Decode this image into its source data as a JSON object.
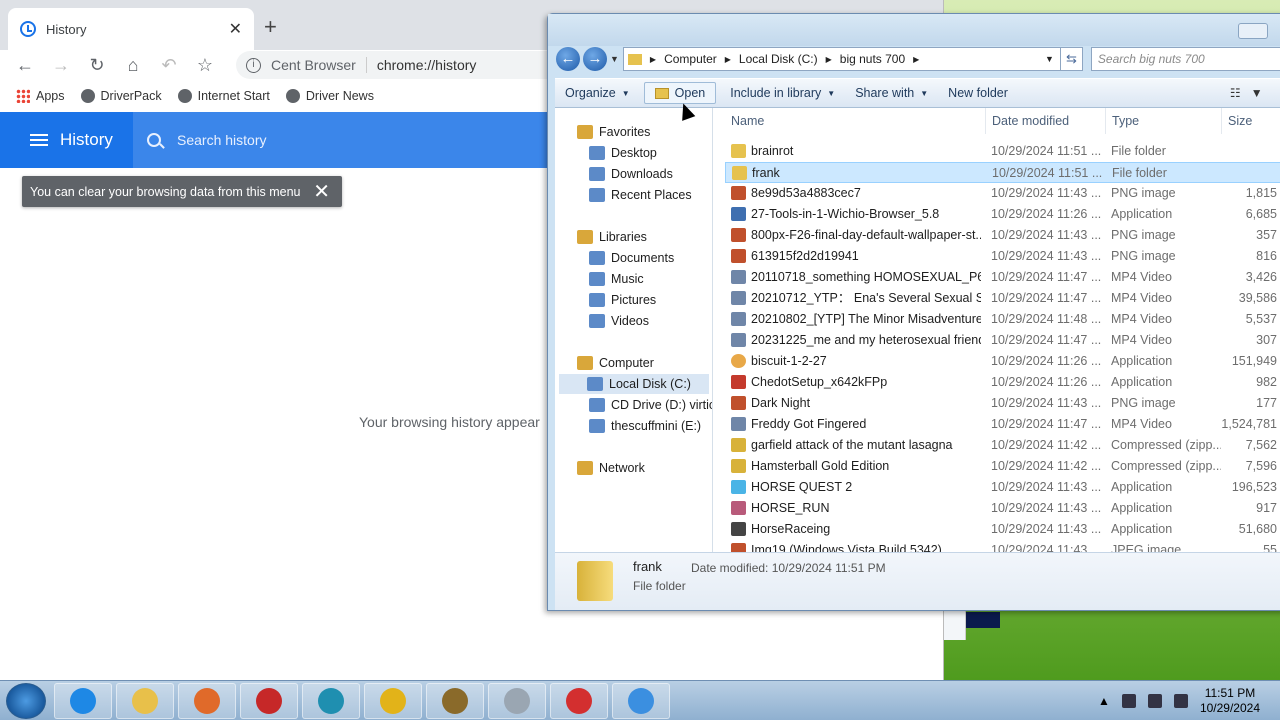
{
  "browser": {
    "tab_title": "History",
    "tab_close": "✕",
    "new_tab": "+",
    "site_label": "Cent Browser",
    "url": "chrome://history",
    "bookmarks": [
      "Apps",
      "DriverPack",
      "Internet Start",
      "Driver News"
    ],
    "history_title": "History",
    "search_placeholder": "Search history",
    "tooltip": "You can clear your browsing data from this menu",
    "empty_message": "Your browsing history appear"
  },
  "explorer": {
    "breadcrumbs": [
      "Computer",
      "Local Disk (C:)",
      "big nuts 700"
    ],
    "search_placeholder": "Search big nuts 700",
    "commands": [
      "Organize",
      "Open",
      "Include in library",
      "Share with",
      "New folder"
    ],
    "columns": [
      "Name",
      "Date modified",
      "Type",
      "Size"
    ],
    "nav": [
      {
        "label": "Favorites",
        "group": true
      },
      {
        "label": "Desktop"
      },
      {
        "label": "Downloads"
      },
      {
        "label": "Recent Places"
      },
      {
        "label": "Libraries",
        "group": true
      },
      {
        "label": "Documents"
      },
      {
        "label": "Music"
      },
      {
        "label": "Pictures"
      },
      {
        "label": "Videos"
      },
      {
        "label": "Computer",
        "group": true
      },
      {
        "label": "Local Disk (C:)",
        "selected": true
      },
      {
        "label": "CD Drive (D:) virtio-v"
      },
      {
        "label": "thescuffmini (E:)"
      },
      {
        "label": "Network",
        "group": true
      }
    ],
    "files": [
      {
        "name": "brainrot",
        "date": "10/29/2024 11:51 ...",
        "type": "File folder",
        "size": "",
        "icon": "folder"
      },
      {
        "name": "frank",
        "date": "10/29/2024 11:51 ...",
        "type": "File folder",
        "size": "",
        "icon": "folder",
        "selected": true
      },
      {
        "name": "8e99d53a4883cec7",
        "date": "10/29/2024 11:43 ...",
        "type": "PNG image",
        "size": "1,815",
        "icon": "image"
      },
      {
        "name": "27-Tools-in-1-Wichio-Browser_5.8",
        "date": "10/29/2024 11:26 ...",
        "type": "Application",
        "size": "6,685",
        "icon": "app"
      },
      {
        "name": "800px-F26-final-day-default-wallpaper-st...",
        "date": "10/29/2024 11:43 ...",
        "type": "PNG image",
        "size": "357",
        "icon": "image"
      },
      {
        "name": "613915f2d2d19941",
        "date": "10/29/2024 11:43 ...",
        "type": "PNG image",
        "size": "816",
        "icon": "image"
      },
      {
        "name": "20110718_something HOMOSEXUAL_P6L...",
        "date": "10/29/2024 11:47 ...",
        "type": "MP4 Video",
        "size": "3,426",
        "icon": "video"
      },
      {
        "name": "20210712_YTP： Ena's Several Sexual Sins",
        "date": "10/29/2024 11:47 ...",
        "type": "MP4 Video",
        "size": "39,586",
        "icon": "video"
      },
      {
        "name": "20210802_[YTP] The Minor Misadventure...",
        "date": "10/29/2024 11:48 ...",
        "type": "MP4 Video",
        "size": "5,537",
        "icon": "video"
      },
      {
        "name": "20231225_me and my heterosexual friend...",
        "date": "10/29/2024 11:47 ...",
        "type": "MP4 Video",
        "size": "307",
        "icon": "video"
      },
      {
        "name": "biscuit-1-2-27",
        "date": "10/29/2024 11:26 ...",
        "type": "Application",
        "size": "151,949",
        "icon": "biscuit"
      },
      {
        "name": "ChedotSetup_x642kFPp",
        "date": "10/29/2024 11:26 ...",
        "type": "Application",
        "size": "982",
        "icon": "chedot"
      },
      {
        "name": "Dark Night",
        "date": "10/29/2024 11:43 ...",
        "type": "PNG image",
        "size": "177",
        "icon": "image"
      },
      {
        "name": "Freddy Got Fingered",
        "date": "10/29/2024 11:47 ...",
        "type": "MP4 Video",
        "size": "1,524,781",
        "icon": "video"
      },
      {
        "name": "garfield attack of the mutant lasagna",
        "date": "10/29/2024 11:42 ...",
        "type": "Compressed (zipp...",
        "size": "7,562",
        "icon": "zip"
      },
      {
        "name": "Hamsterball Gold Edition",
        "date": "10/29/2024 11:42 ...",
        "type": "Compressed (zipp...",
        "size": "7,596",
        "icon": "zip"
      },
      {
        "name": "HORSE QUEST 2",
        "date": "10/29/2024 11:43 ...",
        "type": "Application",
        "size": "196,523",
        "icon": "app2"
      },
      {
        "name": "HORSE_RUN",
        "date": "10/29/2024 11:43 ...",
        "type": "Application",
        "size": "917",
        "icon": "app3"
      },
      {
        "name": "HorseRaceing",
        "date": "10/29/2024 11:43 ...",
        "type": "Application",
        "size": "51,680",
        "icon": "app4"
      },
      {
        "name": "Img19 (Windows Vista Build 5342)",
        "date": "10/29/2024 11:43 ...",
        "type": "JPEG image",
        "size": "55",
        "icon": "image"
      }
    ],
    "details": {
      "name": "frank",
      "modified": "Date modified: 10/29/2024 11:51 PM",
      "type": "File folder"
    }
  },
  "taskbar": {
    "clock_time": "11:51 PM",
    "clock_date": "10/29/2024",
    "apps": [
      "internet-explorer-icon",
      "file-explorer-icon",
      "media-player-icon",
      "app-icon-1",
      "app-icon-2",
      "app-icon-3",
      "app-icon-4",
      "app-icon-5",
      "opera-icon",
      "browser-icon"
    ]
  }
}
